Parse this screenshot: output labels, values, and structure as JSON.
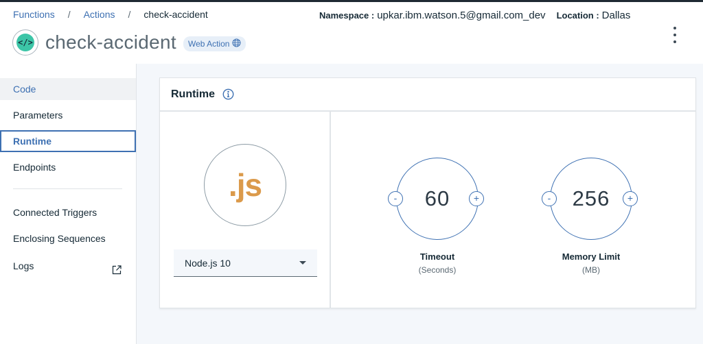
{
  "breadcrumb": {
    "items": [
      "Functions",
      "Actions"
    ],
    "separator": "/",
    "current": "check-accident"
  },
  "action": {
    "icon": "code-icon",
    "icon_glyph": "</>",
    "title": "check-accident",
    "badge": "Web Action",
    "badge_icon": "globe-icon"
  },
  "header_info": {
    "namespace_label": "Namespace :",
    "namespace_value": "upkar.ibm.watson.5@gmail.com_dev",
    "location_label": "Location :",
    "location_value": "Dallas"
  },
  "sidebar": {
    "items": [
      {
        "label": "Code"
      },
      {
        "label": "Parameters"
      },
      {
        "label": "Runtime"
      },
      {
        "label": "Endpoints"
      },
      {
        "label": "Connected Triggers"
      },
      {
        "label": "Enclosing Sequences"
      },
      {
        "label": "Logs",
        "icon": "external-link-icon"
      }
    ],
    "active": "Runtime"
  },
  "runtime_card": {
    "title": "Runtime",
    "title_icon": "info-icon",
    "language_logo": ".js",
    "runtime_selected": "Node.js 10",
    "timeout": {
      "value": "60",
      "label": "Timeout",
      "unit": "(Seconds)",
      "decrement": "-",
      "increment": "+"
    },
    "memory": {
      "value": "256",
      "label": "Memory Limit",
      "unit": "(MB)",
      "decrement": "-",
      "increment": "+"
    }
  },
  "colors": {
    "accent": "#3d70b2",
    "js_logo": "#db9a4b",
    "action_icon": "#3cc5a7"
  }
}
